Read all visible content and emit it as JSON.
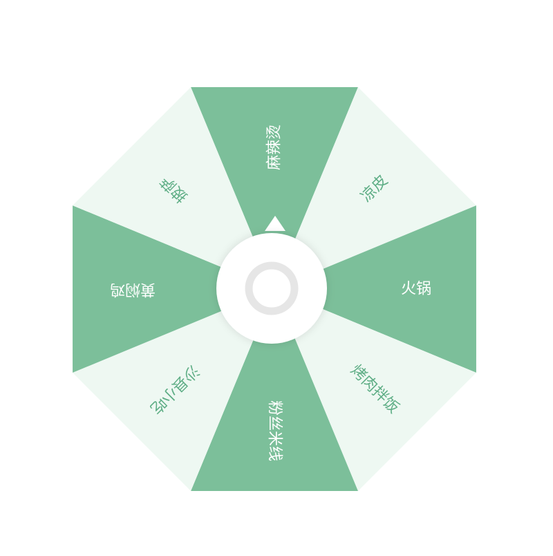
{
  "wheel": {
    "colors": {
      "dark": "#7cbf9a",
      "light": "#eef8f2",
      "text_on_dark": "#ffffff",
      "text_on_light": "#5fae86",
      "hub": "#ffffff",
      "hub_ring": "#e6e6e6",
      "hub_shadow": "#d9d9d9"
    },
    "segments": [
      {
        "label": "麻辣烫",
        "tone": "dark"
      },
      {
        "label": "凉皮",
        "tone": "light"
      },
      {
        "label": "火锅",
        "tone": "dark"
      },
      {
        "label": "烤肉拌饭",
        "tone": "light"
      },
      {
        "label": "粉丝米线",
        "tone": "dark"
      },
      {
        "label": "沙县小吃",
        "tone": "light"
      },
      {
        "label": "黄焖鸡",
        "tone": "dark"
      },
      {
        "label": "披萨",
        "tone": "light"
      }
    ]
  },
  "hub": {
    "pointer": "up-arrow-icon",
    "center": "ring-icon"
  }
}
